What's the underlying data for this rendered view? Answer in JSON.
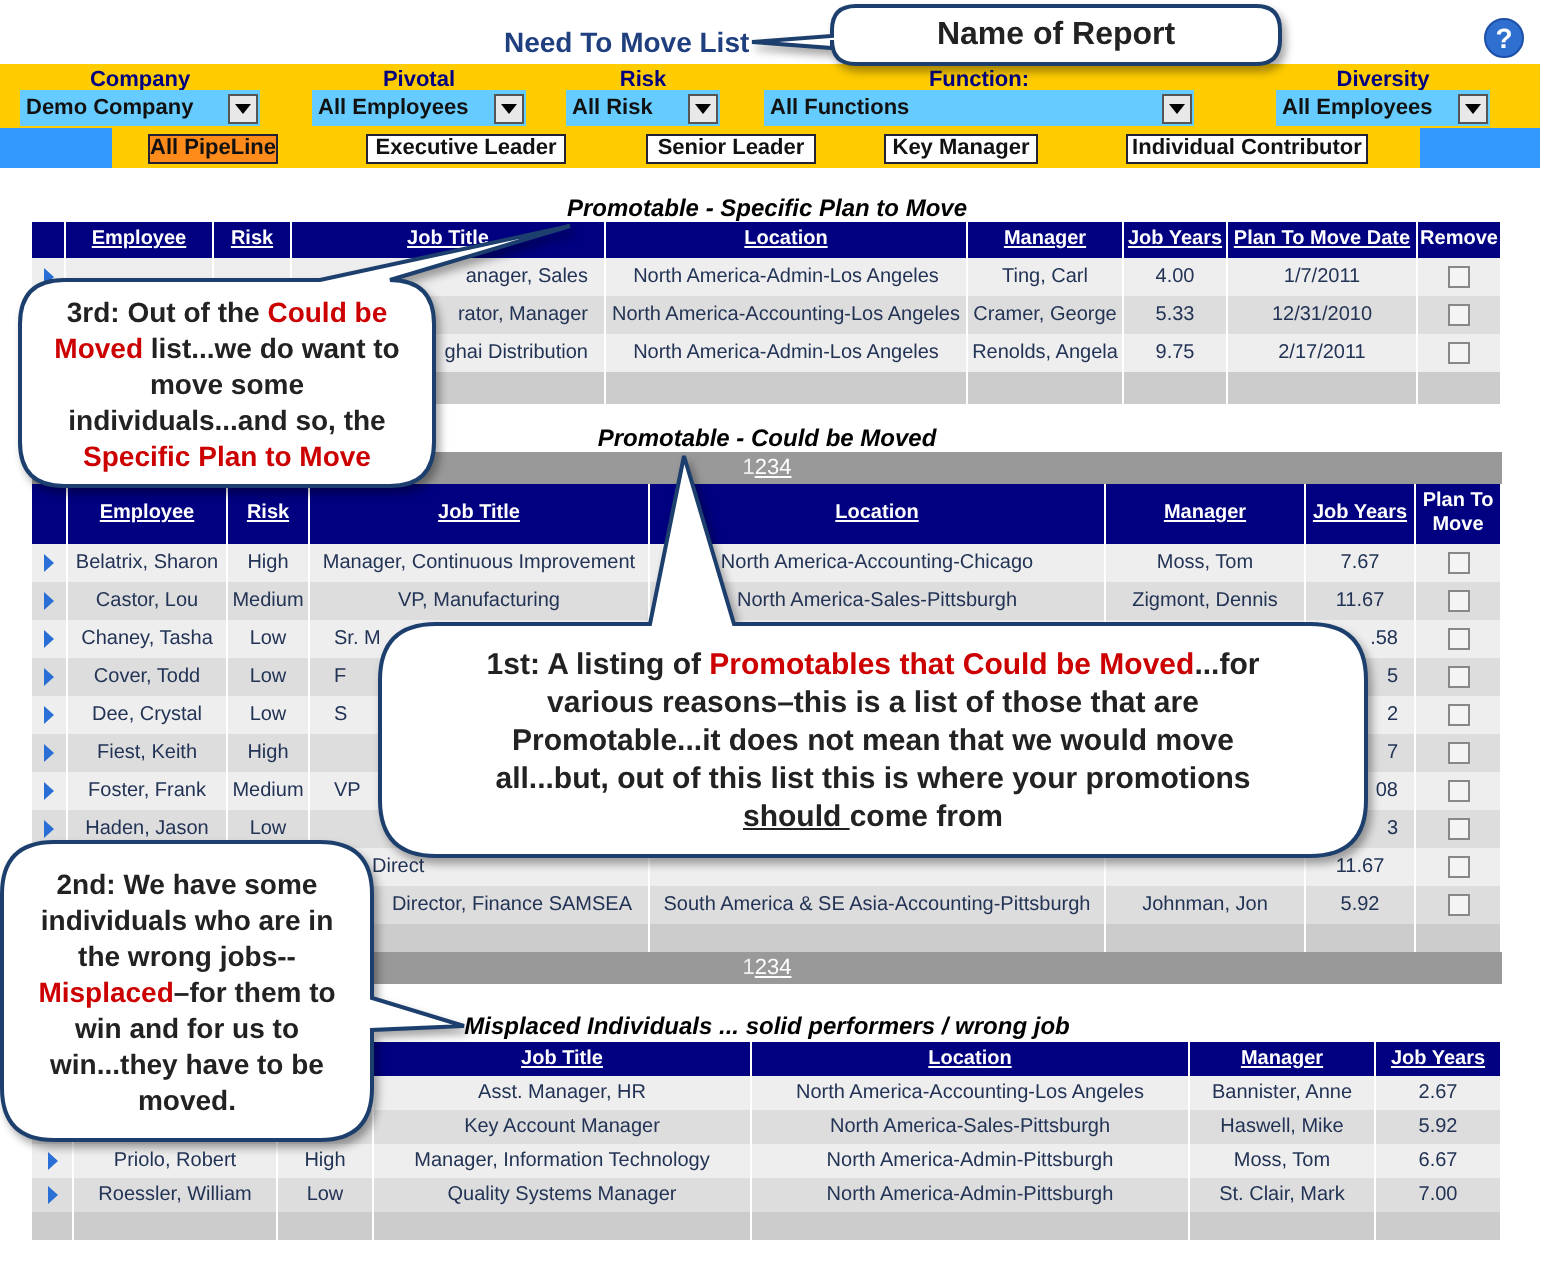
{
  "header": {
    "title": "Need To Move List",
    "help": "?"
  },
  "filters": [
    {
      "label": "Company",
      "value": "Demo Company"
    },
    {
      "label": "Pivotal",
      "value": "All Employees"
    },
    {
      "label": "Risk",
      "value": "All Risk"
    },
    {
      "label": "Function:",
      "value": "All Functions"
    },
    {
      "label": "Diversity",
      "value": "All Employees"
    }
  ],
  "pipeline_tabs": [
    {
      "label": "All PipeLine",
      "selected": true
    },
    {
      "label": "Executive Leader",
      "selected": false
    },
    {
      "label": "Senior Leader",
      "selected": false
    },
    {
      "label": "Key Manager",
      "selected": false
    },
    {
      "label": "Individual Contributor",
      "selected": false
    }
  ],
  "tables": [
    {
      "caption": "Promotable - Specific Plan to Move",
      "columns": [
        {
          "label": "Employee",
          "sortable": true
        },
        {
          "label": "Risk",
          "sortable": true
        },
        {
          "label": "Job Title",
          "sortable": true
        },
        {
          "label": "Location",
          "sortable": true
        },
        {
          "label": "Manager",
          "sortable": true
        },
        {
          "label": "Job Years",
          "sortable": true
        },
        {
          "label": "Plan To Move Date",
          "sortable": true
        },
        {
          "label": "Remove",
          "sortable": false
        }
      ],
      "rows": [
        {
          "cells": [
            null,
            null,
            {
              "text": "anager, Sales",
              "kind": "cut_left"
            },
            "North America-Admin-Los Angeles",
            "Ting, Carl",
            "4.00",
            "1/7/2011"
          ],
          "checked": false
        },
        {
          "cells": [
            null,
            null,
            {
              "text": "rator, Manager",
              "kind": "cut_left"
            },
            "North America-Accounting-Los Angeles",
            "Cramer, George",
            "5.33",
            "12/31/2010"
          ],
          "checked": false
        },
        {
          "cells": [
            null,
            null,
            {
              "text": "ghai Distribution",
              "kind": "cut_left"
            },
            "North America-Admin-Los Angeles",
            "Renolds, Angela",
            "9.75",
            "2/17/2011"
          ],
          "checked": false
        }
      ]
    },
    {
      "caption": "Promotable - Could be Moved",
      "pager_top": [
        {
          "label": "1",
          "selected": true
        },
        {
          "label": "2",
          "selected": false
        },
        {
          "label": "3",
          "selected": false
        },
        {
          "label": "4",
          "selected": false
        }
      ],
      "columns": [
        {
          "label": "Employee",
          "sortable": true
        },
        {
          "label": "Risk",
          "sortable": true
        },
        {
          "label": "Job Title",
          "sortable": true
        },
        {
          "label": "Location",
          "sortable": true
        },
        {
          "label": "Manager",
          "sortable": true
        },
        {
          "label": "Job Years",
          "sortable": true
        },
        {
          "label": "Plan To Move",
          "sortable": false
        }
      ],
      "rows": [
        {
          "cells": [
            "Belatrix, Sharon",
            "High",
            "Manager, Continuous Improvement",
            "North America-Accounting-Chicago",
            "Moss, Tom",
            "7.67"
          ],
          "checked": false
        },
        {
          "cells": [
            "Castor, Lou",
            "Medium",
            "VP, Manufacturing",
            "North America-Sales-Pittsburgh",
            "Zigmont, Dennis",
            "11.67"
          ],
          "checked": false
        },
        {
          "cells": [
            "Chaney, Tasha",
            "Low",
            {
              "text": "Sr. M",
              "kind": "cut_right"
            },
            null,
            null,
            {
              "text": ".58",
              "kind": "cut_left"
            }
          ],
          "checked": false
        },
        {
          "cells": [
            "Cover, Todd",
            "Low",
            {
              "text": "F",
              "kind": "cut_right"
            },
            null,
            null,
            {
              "text": "5",
              "kind": "cut_left"
            }
          ],
          "checked": false
        },
        {
          "cells": [
            "Dee, Crystal",
            "Low",
            {
              "text": "S",
              "kind": "cut_right"
            },
            null,
            null,
            {
              "text": "2",
              "kind": "cut_left"
            }
          ],
          "checked": false
        },
        {
          "cells": [
            "Fiest, Keith",
            "High",
            null,
            null,
            null,
            {
              "text": "7",
              "kind": "cut_left"
            }
          ],
          "checked": false
        },
        {
          "cells": [
            "Foster, Frank",
            "Medium",
            {
              "text": "VP",
              "kind": "cut_right"
            },
            null,
            null,
            {
              "text": "08",
              "kind": "cut_left"
            }
          ],
          "checked": false
        },
        {
          "cells": [
            "Haden, Jason",
            "Low",
            null,
            null,
            null,
            {
              "text": "3",
              "kind": "cut_left"
            }
          ],
          "checked": false
        },
        {
          "cells": [
            null,
            null,
            {
              "text": "Direct",
              "kind": "cut_both"
            },
            null,
            null,
            "11.67"
          ],
          "checked": false
        },
        {
          "cells": [
            null,
            null,
            {
              "text": "Director, Finance SAMSEA",
              "kind": "cut_left"
            },
            "South America & SE Asia-Accounting-Pittsburgh",
            "Johnman, Jon",
            "5.92"
          ],
          "checked": false
        }
      ],
      "pager_bottom": [
        {
          "label": "1",
          "selected": true
        },
        {
          "label": "2",
          "selected": false
        },
        {
          "label": "3",
          "selected": false
        },
        {
          "label": "4",
          "selected": false
        }
      ]
    },
    {
      "caption": "Misplaced Individuals ... solid performers / wrong job",
      "columns": [
        null,
        null,
        {
          "label": "Job Title",
          "sortable": true
        },
        {
          "label": "Location",
          "sortable": true
        },
        {
          "label": "Manager",
          "sortable": true
        },
        {
          "label": "Job Years",
          "sortable": true
        }
      ],
      "rows": [
        {
          "cells": [
            null,
            null,
            "Asst. Manager, HR",
            "North America-Accounting-Los Angeles",
            "Bannister, Anne",
            "2.67"
          ]
        },
        {
          "cells": [
            null,
            null,
            "Key Account Manager",
            "North America-Sales-Pittsburgh",
            "Haswell, Mike",
            "5.92"
          ]
        },
        {
          "cells": [
            "Priolo, Robert",
            "High",
            "Manager, Information Technology",
            "North America-Admin-Pittsburgh",
            "Moss, Tom",
            "6.67"
          ]
        },
        {
          "cells": [
            "Roessler, William",
            "Low",
            "Quality Systems Manager",
            "North America-Admin-Pittsburgh",
            "St. Clair, Mark",
            "7.00"
          ]
        }
      ]
    }
  ],
  "callouts": [
    {
      "segments": [
        {
          "kind": "plain",
          "text": "Name of Report"
        }
      ]
    },
    {
      "segments": [
        {
          "kind": "plain",
          "text": "3rd: Out of the "
        },
        {
          "kind": "red",
          "text": "Could be Moved"
        },
        {
          "kind": "plain",
          "text": " list...we do want to move some individuals...and so, the "
        },
        {
          "kind": "red",
          "text": "Specific Plan to Move"
        }
      ]
    },
    {
      "segments": [
        {
          "kind": "plain",
          "text": "1st: A listing of "
        },
        {
          "kind": "red",
          "text": "Promotables that Could be Moved"
        },
        {
          "kind": "plain",
          "text": "...for various reasons–this is a list of those that are Promotable...it does not mean that we would move all...but, out of this list this is where your promotions "
        },
        {
          "kind": "underline",
          "text": "should "
        },
        {
          "kind": "plain",
          "text": "come from"
        }
      ]
    },
    {
      "segments": [
        {
          "kind": "plain",
          "text": "2nd: We have some individuals who are in the wrong jobs--"
        },
        {
          "kind": "red",
          "text": "Misplaced"
        },
        {
          "kind": "plain",
          "text": "–for them to win and for us to win...they have to be moved."
        }
      ]
    }
  ]
}
